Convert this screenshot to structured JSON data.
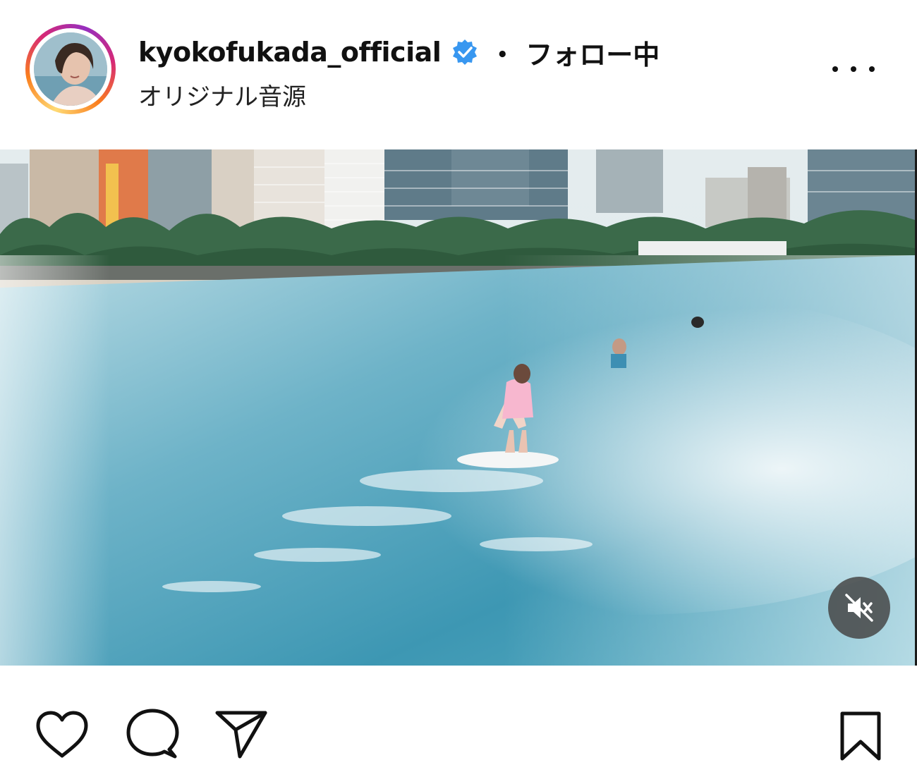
{
  "header": {
    "username": "kyokofukada_official",
    "separator": "・",
    "follow_status": "フォロー中",
    "audio": "オリジナル音源",
    "verified_color": "#3897f0"
  },
  "icons": {
    "avatar": "profile-photo",
    "verified": "verified-badge-icon",
    "more": "more-options-icon",
    "mute": "muted-speaker-icon",
    "like": "heart-icon",
    "comment": "comment-bubble-icon",
    "share": "paper-plane-icon",
    "save": "bookmark-icon"
  },
  "colors": {
    "story_ring": [
      "#feda75",
      "#fa7e1e",
      "#d62976",
      "#962fbf"
    ],
    "text": "#111111"
  }
}
